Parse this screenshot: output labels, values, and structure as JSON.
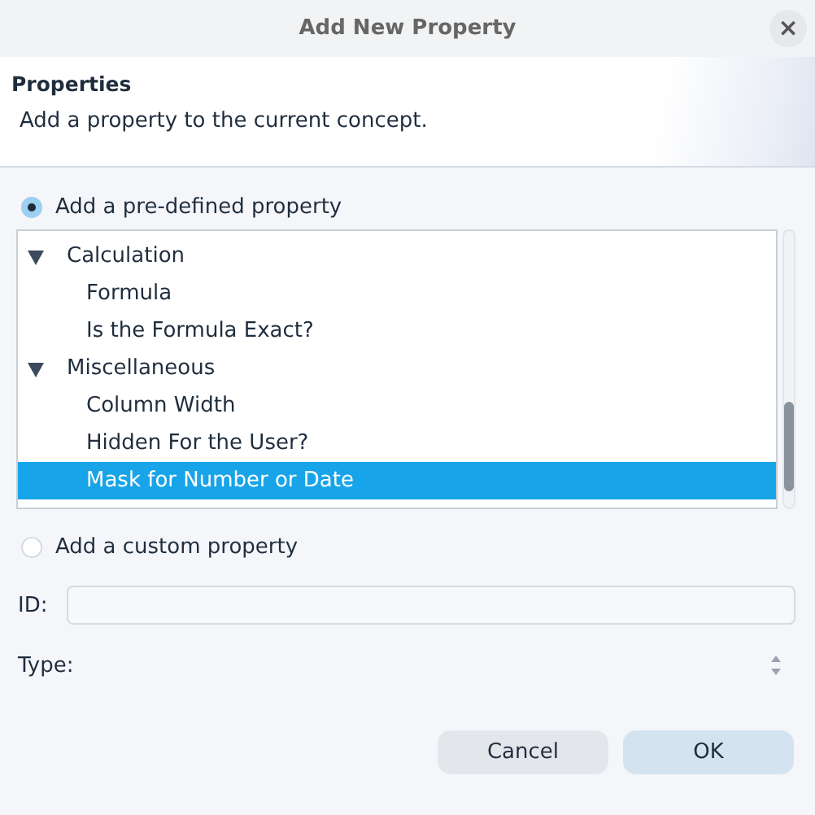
{
  "window": {
    "title": "Add New Property",
    "close": "×"
  },
  "header": {
    "title": "Properties",
    "description": "Add a property to the current concept."
  },
  "options": [
    {
      "label": "Add a pre-defined property",
      "selected": true
    },
    {
      "label": "Add a custom property",
      "selected": false
    }
  ],
  "tree": [
    {
      "label": "Calculation",
      "expanded": true,
      "selected": false,
      "children": [
        {
          "label": "Formula",
          "selected": false
        },
        {
          "label": "Is the Formula Exact?",
          "selected": false
        }
      ]
    },
    {
      "label": "Miscellaneous",
      "expanded": true,
      "selected": false,
      "children": [
        {
          "label": "Column Width",
          "selected": false
        },
        {
          "label": "Hidden For the User?",
          "selected": false
        },
        {
          "label": "Mask for Number or Date",
          "selected": true
        }
      ]
    }
  ],
  "id_field": {
    "label": "ID:"
  },
  "type_field": {
    "label": "Type:"
  },
  "buttons": [
    "Cancel",
    "OK"
  ]
}
